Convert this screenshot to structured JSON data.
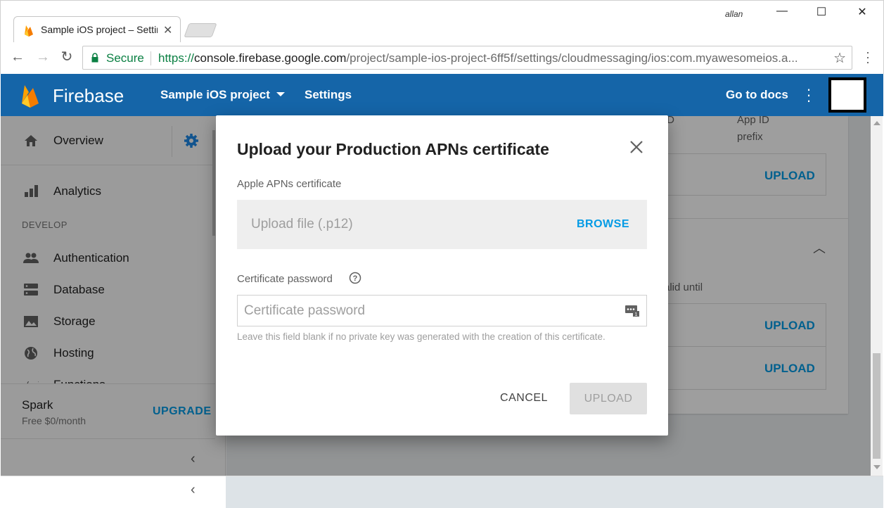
{
  "browser": {
    "tab_title": "Sample iOS project – Settings",
    "user": "allan",
    "secure_label": "Secure",
    "url_scheme": "https://",
    "url_host": "console.firebase.google.com",
    "url_path": "/project/sample-ios-project-6ff5f/settings/cloudmessaging/ios:com.myawesomeios.a..."
  },
  "header": {
    "brand": "Firebase",
    "project": "Sample iOS project",
    "section": "Settings",
    "docs_link": "Go to docs",
    "colors": {
      "header_bg": "#1565a8"
    }
  },
  "sidebar": {
    "overview": "Overview",
    "analytics": "Analytics",
    "section_develop": "DEVELOP",
    "items": [
      {
        "label": "Authentication",
        "icon": "people-icon"
      },
      {
        "label": "Database",
        "icon": "database-icon"
      },
      {
        "label": "Storage",
        "icon": "image-icon"
      },
      {
        "label": "Hosting",
        "icon": "globe-icon"
      },
      {
        "label": "Functions",
        "icon": "functions-icon"
      }
    ],
    "plan_name": "Spark",
    "plan_price": "Free $0/month",
    "upgrade": "UPGRADE"
  },
  "background": {
    "col_id_tail": "ID",
    "col_app_id": "App ID",
    "col_prefix": "prefix",
    "valid_until": "alid until",
    "upload": "UPLOAD"
  },
  "dialog": {
    "title": "Upload your Production APNs certificate",
    "cert_label": "Apple APNs certificate",
    "file_placeholder": "Upload file (.p12)",
    "browse": "BROWSE",
    "password_label": "Certificate password",
    "password_placeholder": "Certificate password",
    "hint": "Leave this field blank if no private key was generated with the creation of this certificate.",
    "cancel": "CANCEL",
    "upload": "UPLOAD",
    "colors": {
      "link": "#039be5"
    }
  }
}
